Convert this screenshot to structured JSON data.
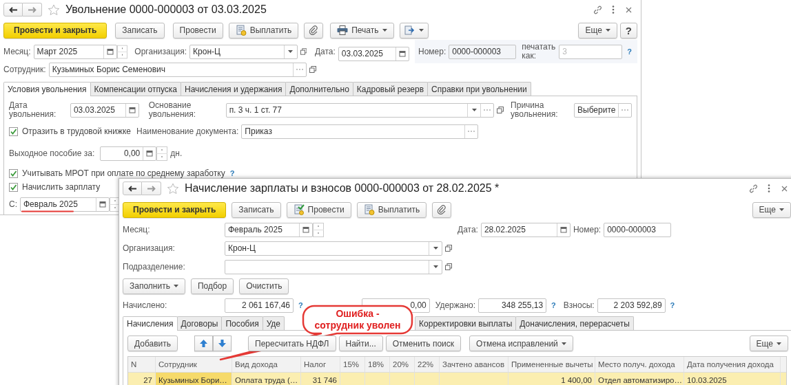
{
  "back_window": {
    "title": "Увольнение 0000-000003 от 03.03.2025",
    "toolbar": [
      {
        "label": "Провести и закрыть",
        "kind": "primary"
      },
      {
        "label": "Записать",
        "kind": "plain"
      },
      {
        "label": "Провести",
        "kind": "plain"
      },
      {
        "label": "Выплатить",
        "kind": "pay"
      },
      {
        "kind": "attach"
      },
      {
        "label": "Печать",
        "kind": "print"
      },
      {
        "kind": "goto"
      }
    ],
    "more_button": "Еще",
    "help_button": "?",
    "month": {
      "label": "Месяц:",
      "value": "Март 2025"
    },
    "organization": {
      "label": "Организация:",
      "value": "Крон-Ц"
    },
    "date": {
      "label": "Дата:",
      "value": "03.03.2025"
    },
    "number": {
      "label": "Номер:",
      "value": "0000-000003"
    },
    "print_as": {
      "label": "печатать как:",
      "placeholder": "3",
      "help": "?"
    },
    "employee": {
      "label": "Сотрудник:",
      "value": "Кузьминых Борис Семенович"
    },
    "tabs": [
      {
        "label": "Условия увольнения",
        "selected": true
      },
      {
        "label": "Компенсации отпуска",
        "selected": false
      },
      {
        "label": "Начисления и удержания",
        "selected": false
      },
      {
        "label": "Дополнительно",
        "selected": false
      },
      {
        "label": "Кадровый резерв",
        "selected": false
      },
      {
        "label": "Справки при увольнении",
        "selected": false
      }
    ],
    "dismissal_date": {
      "label": "Дата увольнения:",
      "value": "03.03.2025"
    },
    "basis": {
      "label": "Основание увольнения:",
      "value": "п. 3 ч. 1 ст. 77"
    },
    "reason": {
      "label": "Причина увольнения:",
      "value": "Выберите"
    },
    "work_book": {
      "label": "Отразить в трудовой книжке",
      "checked": true
    },
    "document_name": {
      "label": "Наименование документа:",
      "value": "Приказ"
    },
    "severance": {
      "label": "Выходное пособие за:",
      "value": "0,00",
      "unit": "дн."
    },
    "mrot": {
      "label": "Учитывать МРОТ при оплате по среднему заработку",
      "checked": true,
      "help": "?"
    },
    "accrue_salary": {
      "label": "Начислить зарплату",
      "checked": true
    },
    "from": {
      "label": "С:",
      "value": "Февраль 2025",
      "underlined": true
    }
  },
  "front_window": {
    "title": "Начисление зарплаты и взносов 0000-000003 от 28.02.2025 *",
    "toolbar": [
      {
        "label": "Провести и закрыть",
        "kind": "primary"
      },
      {
        "label": "Записать",
        "kind": "plain"
      },
      {
        "label": "Провести",
        "kind": "post"
      },
      {
        "label": "Выплатить",
        "kind": "pay"
      },
      {
        "kind": "attach"
      }
    ],
    "more_button": "Еще",
    "month": {
      "label": "Месяц:",
      "value": "Февраль 2025"
    },
    "date": {
      "label": "Дата:",
      "value": "28.02.2025"
    },
    "number": {
      "label": "Номер:",
      "value": "0000-000003"
    },
    "organization": {
      "label": "Организация:",
      "value": "Крон-Ц"
    },
    "department": {
      "label": "Подразделение:"
    },
    "fill_buttons": [
      {
        "label": "Заполнить",
        "dropdown": true
      },
      {
        "label": "Подбор",
        "dropdown": false
      },
      {
        "label": "Очистить",
        "dropdown": false
      }
    ],
    "totals": [
      {
        "label": "Начислено:",
        "value": "2 061 167,46",
        "help": "?"
      },
      {
        "value": "0,00"
      },
      {
        "label": "Удержано:",
        "value": "348 255,13",
        "help": "?"
      },
      {
        "label": "Взносы:",
        "value": "2 203 592,89",
        "help": "?"
      }
    ],
    "tabs": [
      {
        "label": "Начисления",
        "selected": true
      },
      {
        "label": "Договоры",
        "selected": false
      },
      {
        "label": "Пособия",
        "selected": false
      },
      {
        "label": "Уде",
        "selected": false
      },
      {
        "label": "Корректировки выплаты",
        "selected": false
      },
      {
        "label": "Доначисления, перерасчеты",
        "selected": false
      }
    ],
    "table_toolbar": {
      "add": "Добавить",
      "recalc": "Пересчитать НДФЛ",
      "find": "Найти...",
      "cancel_search": "Отменить поиск",
      "cancel_fixes": "Отмена исправлений",
      "more": "Еще"
    },
    "table": {
      "columns": [
        "N",
        "Сотрудник",
        "Вид дохода",
        "Налог",
        "15%",
        "18%",
        "20%",
        "22%",
        "Зачтено авансов",
        "Примененные вычеты",
        "Место получ. дохода",
        "Дата получения дохода"
      ],
      "rows": [
        {
          "selected": true,
          "cells": [
            "27",
            "Кузьминых Бори…",
            "Оплата труда (…",
            "31 746",
            "",
            "",
            "",
            "",
            "",
            "1 400,00",
            "Отдел автоматизиро…",
            "10.03.2025"
          ]
        }
      ]
    }
  },
  "callout": {
    "text": "Ошибка - сотрудник уволен"
  }
}
